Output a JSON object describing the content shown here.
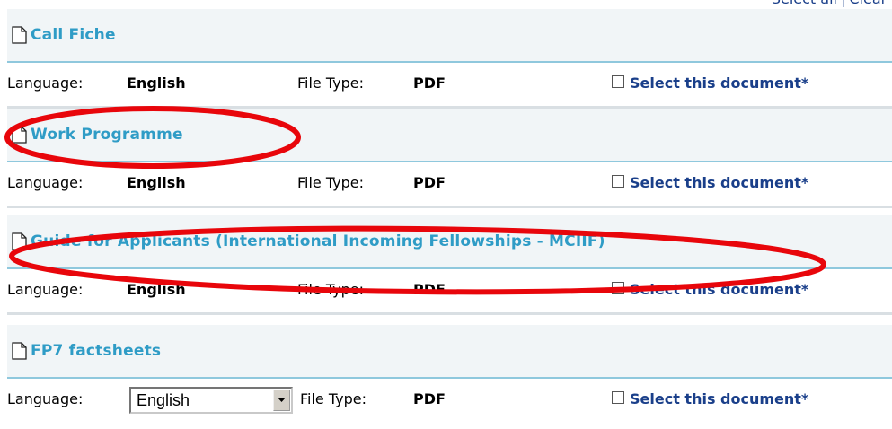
{
  "top_links": {
    "select_all": "Select all",
    "separator": "|",
    "clear": "Clear all"
  },
  "documents": [
    {
      "title": "Call Fiche",
      "language_label": "Language:",
      "language": "English",
      "filetype_label": "File Type:",
      "filetype": "PDF",
      "select_label": "Select this document*"
    },
    {
      "title": "Work Programme",
      "language_label": "Language:",
      "language": "English",
      "filetype_label": "File Type:",
      "filetype": "PDF",
      "select_label": "Select this document*"
    },
    {
      "title": "Guide for Applicants (International Incoming Fellowships - MCIIF)",
      "language_label": "Language:",
      "language": "English",
      "filetype_label": "File Type:",
      "filetype": "PDF",
      "select_label": "Select this document*"
    },
    {
      "title": "FP7 factsheets",
      "language_label": "Language:",
      "language_select": "English",
      "filetype_label": "File Type:",
      "filetype": "PDF",
      "select_label": "Select this document*"
    }
  ],
  "colors": {
    "title_link": "#2f9cc6",
    "select_link": "#1a3f8a",
    "annotation": "#e8060b",
    "divider": "#8fc8dd"
  },
  "icons": {
    "document": "document-icon",
    "dropdown": "chevron-down-icon"
  }
}
